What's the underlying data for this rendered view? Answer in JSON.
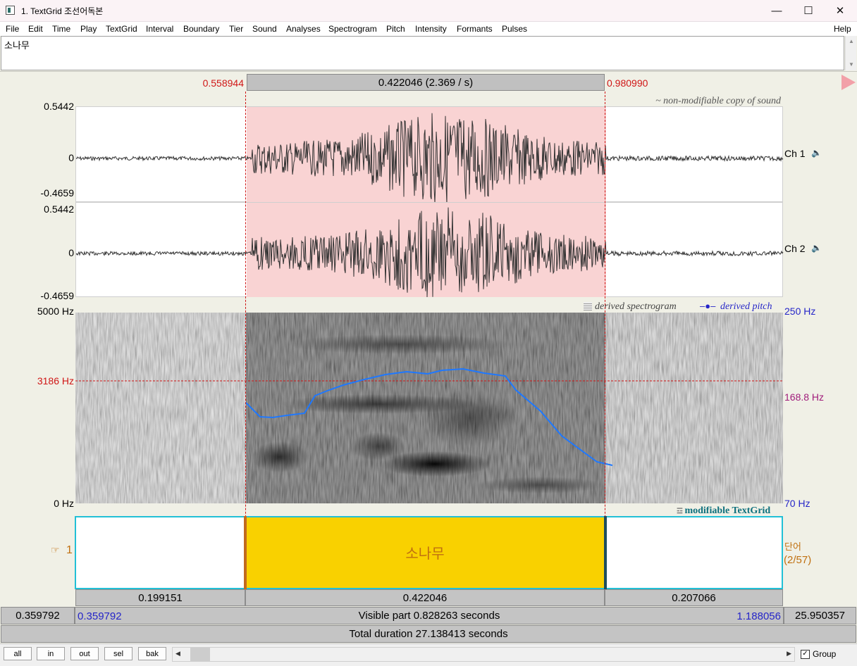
{
  "window": {
    "title": "1. TextGrid 조선어독본",
    "minimize_glyph": "—",
    "maximize_glyph": "☐",
    "close_glyph": "✕"
  },
  "menu": [
    "File",
    "Edit",
    "Time",
    "Play",
    "TextGrid",
    "Interval",
    "Boundary",
    "Tier",
    "Sound",
    "Analyses",
    "Spectrogram",
    "Pitch",
    "Intensity",
    "Formants",
    "Pulses"
  ],
  "help_label": "Help",
  "textbox": {
    "value": "소나무"
  },
  "selection": {
    "start": "0.558944",
    "end": "0.980990",
    "duration_label": "0.422046 (2.369 / s)"
  },
  "sound": {
    "note": "~ non-modifiable copy of sound",
    "channels": [
      {
        "label": "Ch 1",
        "max": "0.5442",
        "zero": "0",
        "min": "-0.4659"
      },
      {
        "label": "Ch 2",
        "max": "0.5442",
        "zero": "0",
        "min": "-0.4659"
      }
    ],
    "speaker_icon": "speaker-icon"
  },
  "spectrogram": {
    "note": "derived spectrogram",
    "pitch_note": "derived pitch",
    "freq_top": "5000 Hz",
    "freq_cursor": "3186 Hz",
    "freq_bottom": "0 Hz",
    "pitch_top": "250 Hz",
    "pitch_cursor": "168.8 Hz",
    "pitch_bottom": "70 Hz"
  },
  "textgrid": {
    "note": "modifiable TextGrid",
    "tier_number": "1",
    "tier_name": "단어",
    "tier_count": "(2/57)",
    "interval_text": "소나무",
    "durations": [
      "0.199151",
      "0.422046",
      "0.207066"
    ]
  },
  "window_info": {
    "left_total": "0.359792",
    "visible_start": "0.359792",
    "visible_label": "Visible part 0.828263 seconds",
    "visible_end": "1.188056",
    "right_total": "25.950357",
    "total_label": "Total duration 27.138413 seconds"
  },
  "buttons": [
    "all",
    "in",
    "out",
    "sel",
    "bak"
  ],
  "group_label": "Group",
  "colors": {
    "selection_pink": "#f9d3d3",
    "interval_yellow": "#f9d100",
    "pitch_blue": "#1e78ff",
    "tier_cyan": "#22c0d6",
    "red_text": "#d01616"
  }
}
